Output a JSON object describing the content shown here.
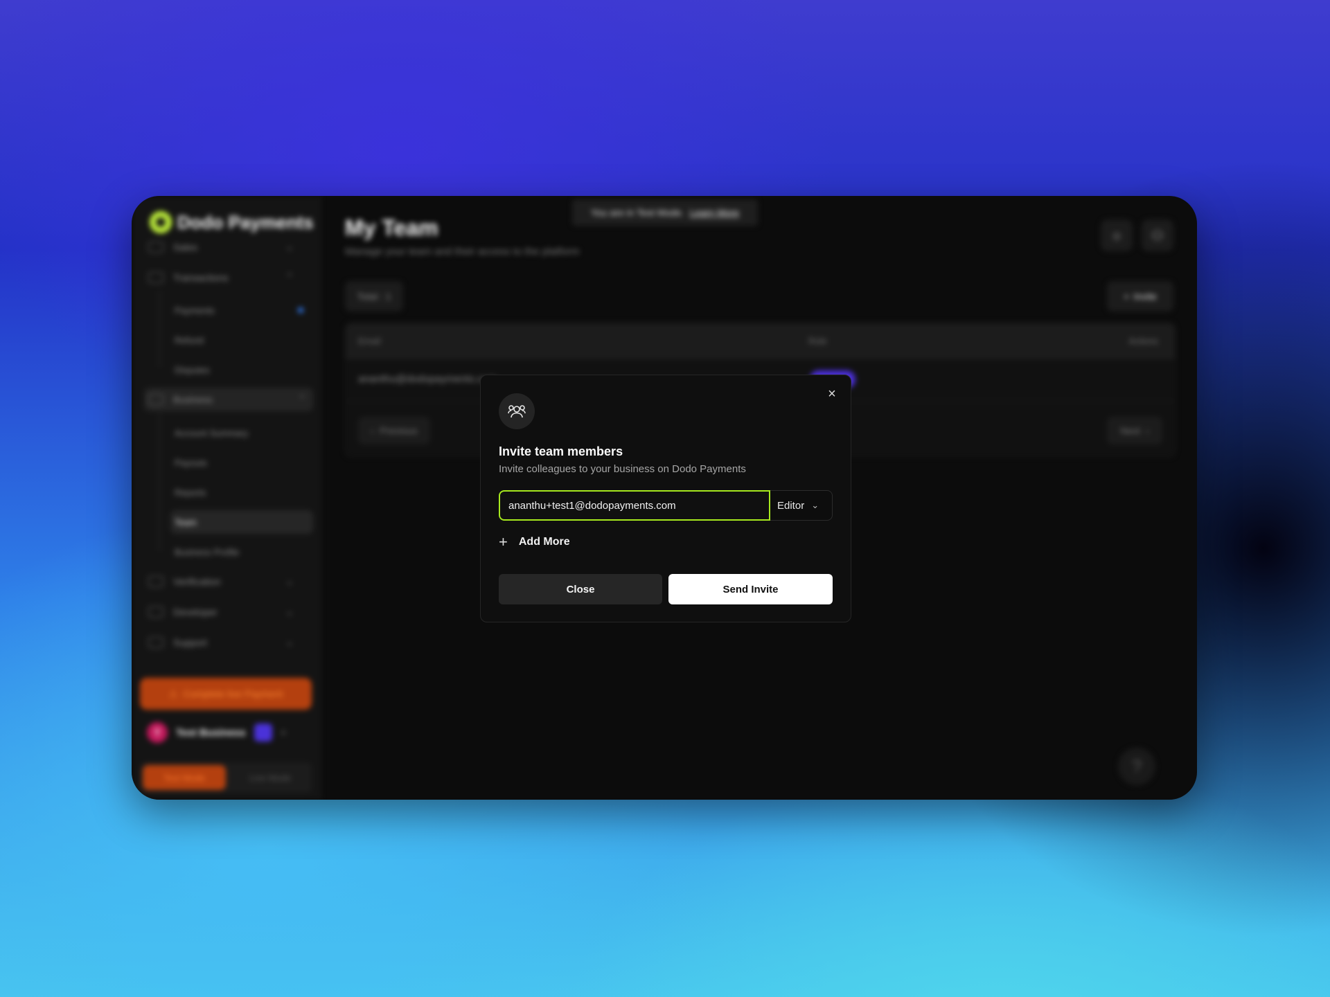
{
  "app": {
    "brand": "Dodo Payments",
    "test_banner": {
      "text": "You are in Test Mode.",
      "link": "Learn More"
    }
  },
  "sidebar": {
    "items": [
      {
        "label": "Sales",
        "icon": "wallet-icon",
        "expanded": false
      },
      {
        "label": "Transactions",
        "icon": "transactions-icon",
        "expanded": true,
        "children": [
          {
            "label": "Payments",
            "has_dot": true
          },
          {
            "label": "Refund"
          },
          {
            "label": "Disputes"
          }
        ]
      },
      {
        "label": "Business",
        "icon": "store-icon",
        "expanded": true,
        "children": [
          {
            "label": "Account Summary"
          },
          {
            "label": "Payouts"
          },
          {
            "label": "Reports"
          },
          {
            "label": "Team",
            "active": true
          },
          {
            "label": "Business Profile"
          }
        ]
      },
      {
        "label": "Verification",
        "icon": "check-circle-icon",
        "expanded": false
      },
      {
        "label": "Developer",
        "icon": "terminal-icon",
        "expanded": false
      },
      {
        "label": "Support",
        "icon": "globe-icon",
        "expanded": false
      }
    ],
    "cta": "Complete live Payment",
    "business": {
      "initial": "T",
      "name": "Test Business"
    },
    "mode_toggle": {
      "test": "Test Mode",
      "live": "Live Mode",
      "selected": "Test Mode"
    }
  },
  "page": {
    "title": "My Team",
    "subtitle": "Manage your team and their access to the platform",
    "total": "Total : 1",
    "invite_button": "Invite",
    "table": {
      "columns": [
        "Email",
        "Role",
        "Actions"
      ],
      "rows": [
        {
          "email": "ananthu@dodopayments.com"
        }
      ]
    },
    "pagination": {
      "previous": "Previous",
      "next": "Next"
    }
  },
  "modal": {
    "title": "Invite team members",
    "subtitle": "Invite colleagues to your business on Dodo Payments",
    "email_value": "ananthu+test1@dodopayments.com",
    "role_value": "Editor",
    "add_more": "Add More",
    "close_button": "Close",
    "send_button": "Send Invite"
  },
  "colors": {
    "accent": "#a7e91e",
    "warning": "#b4400f",
    "link_dot": "#2f7cf6"
  }
}
